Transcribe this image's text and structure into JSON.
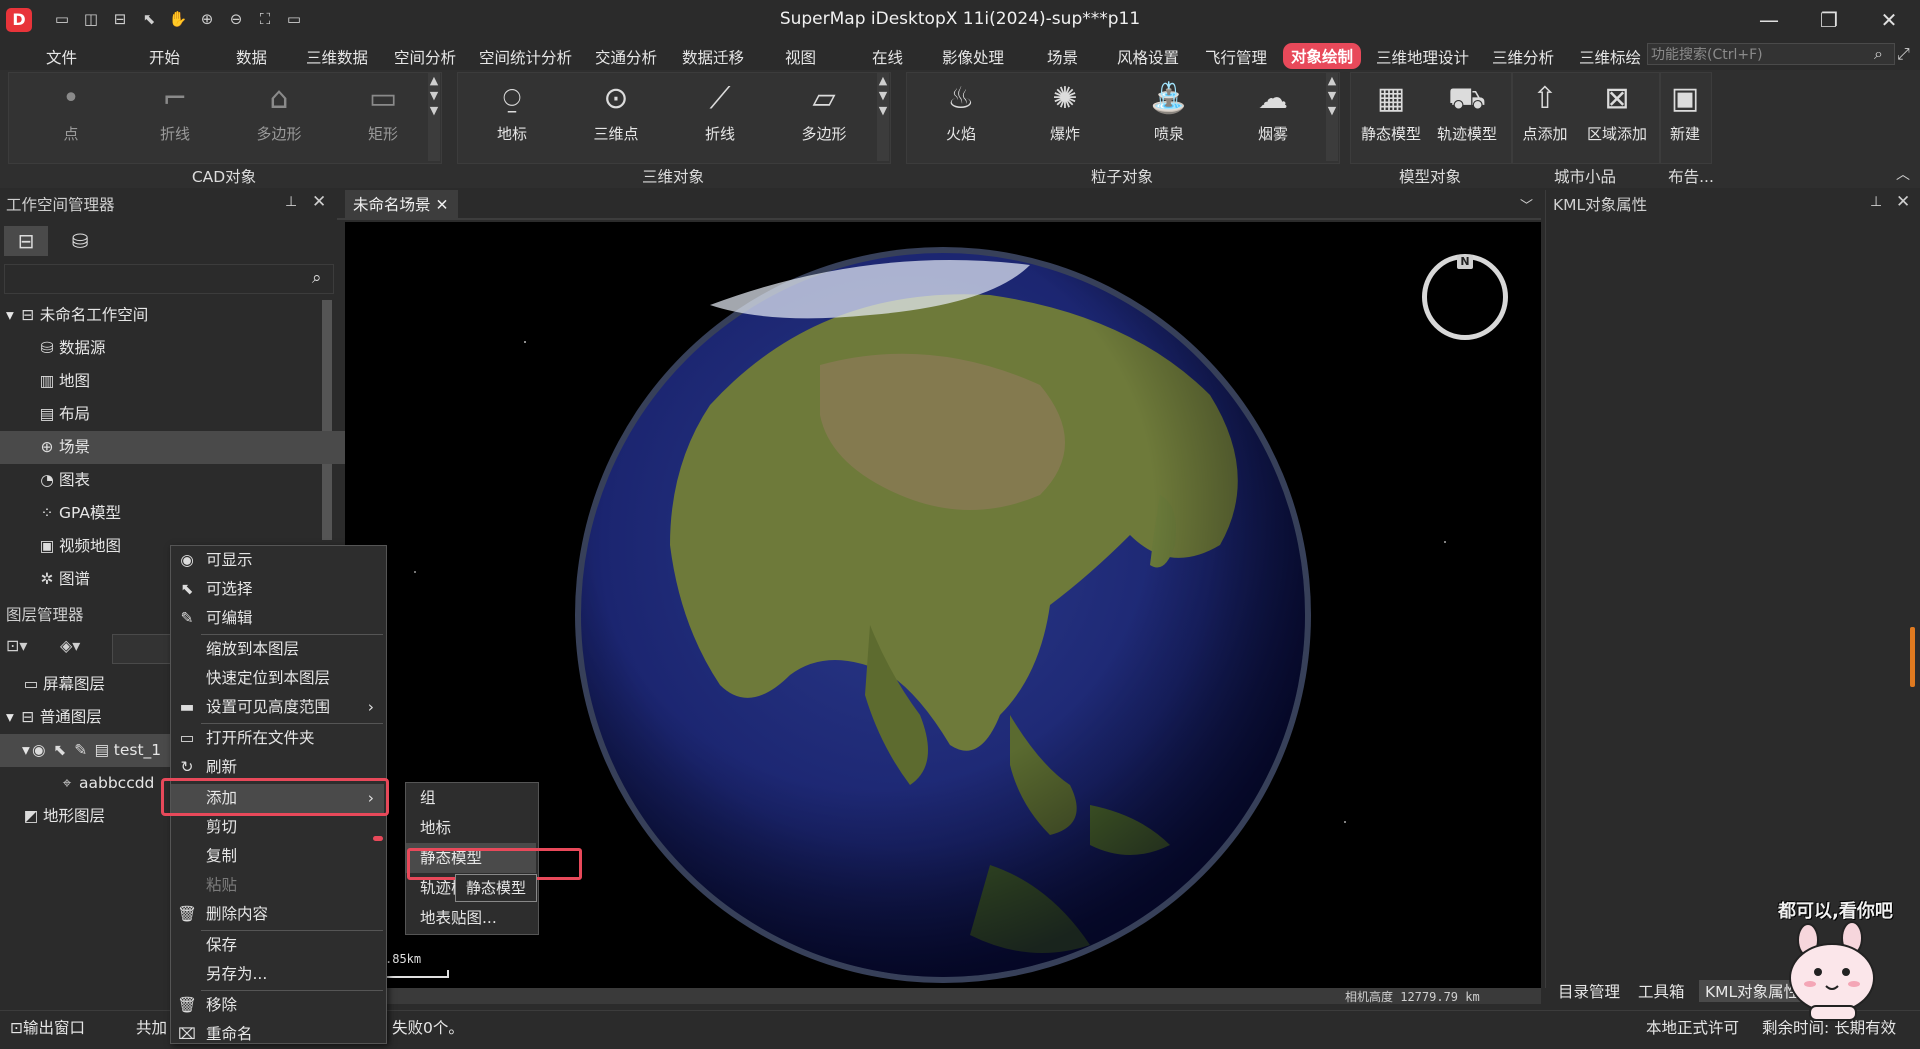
{
  "titlebar": {
    "logo": "D",
    "title": "SuperMap iDesktopX 11i(2024)-sup***p11",
    "quick_access_icons": [
      "save-icon",
      "open-workspace-icon",
      "close-workspace-icon",
      "select-icon",
      "pan-icon",
      "zoom-in-icon",
      "zoom-out-icon",
      "full-extent-icon",
      "folder-icon"
    ],
    "window_buttons": [
      "minimize-icon",
      "restore-icon",
      "close-icon"
    ]
  },
  "menu": {
    "items": [
      "文件",
      "开始",
      "数据",
      "三维数据",
      "空间分析",
      "空间统计分析",
      "交通分析",
      "数据迁移",
      "视图",
      "在线",
      "影像处理",
      "场景",
      "风格设置",
      "飞行管理",
      "对象绘制",
      "三维地理设计",
      "三维分析",
      "三维标绘"
    ],
    "active": "对象绘制",
    "search_placeholder": "功能搜索(Ctrl+F)"
  },
  "ribbon": {
    "cad": {
      "label": "CAD对象",
      "buttons": [
        {
          "label": "点",
          "icon": "point-icon"
        },
        {
          "label": "折线",
          "icon": "polyline-icon"
        },
        {
          "label": "多边形",
          "icon": "polygon-icon"
        },
        {
          "label": "矩形",
          "icon": "rectangle-icon"
        }
      ]
    },
    "three_d": {
      "label": "三维对象",
      "buttons": [
        {
          "label": "地标",
          "icon": "landmark-icon"
        },
        {
          "label": "三维点",
          "icon": "3d-point-icon"
        },
        {
          "label": "折线",
          "icon": "3d-polyline-icon"
        },
        {
          "label": "多边形",
          "icon": "3d-polygon-icon"
        }
      ]
    },
    "particle": {
      "label": "粒子对象",
      "buttons": [
        {
          "label": "火焰",
          "icon": "flame-icon"
        },
        {
          "label": "爆炸",
          "icon": "explosion-icon"
        },
        {
          "label": "喷泉",
          "icon": "fountain-icon"
        },
        {
          "label": "烟雾",
          "icon": "smoke-icon"
        }
      ]
    },
    "model": {
      "label": "模型对象",
      "buttons": [
        {
          "label": "静态模型",
          "icon": "static-model-icon"
        },
        {
          "label": "轨迹模型",
          "icon": "track-model-icon"
        }
      ]
    },
    "city": {
      "label": "城市小品",
      "buttons": [
        {
          "label": "点添加",
          "icon": "point-add-icon"
        },
        {
          "label": "区域添加",
          "icon": "region-add-icon"
        }
      ]
    },
    "board": {
      "label": "布告...",
      "buttons": [
        {
          "label": "新建",
          "icon": "new-board-icon"
        }
      ]
    }
  },
  "workspace": {
    "title": "工作空间管理器",
    "tree": [
      {
        "label": "未命名工作空间",
        "icon": "workspace-icon"
      },
      {
        "label": "数据源",
        "icon": "datasource-icon"
      },
      {
        "label": "地图",
        "icon": "map-icon"
      },
      {
        "label": "布局",
        "icon": "layout-icon"
      },
      {
        "label": "场景",
        "icon": "scene-icon"
      },
      {
        "label": "图表",
        "icon": "chart-icon"
      },
      {
        "label": "GPA模型",
        "icon": "gpa-model-icon"
      },
      {
        "label": "视频地图",
        "icon": "video-map-icon"
      },
      {
        "label": "图谱",
        "icon": "graph-icon"
      }
    ]
  },
  "layers": {
    "title": "图层管理器",
    "tree": [
      {
        "label": "屏幕图层",
        "icon": "screen-layer-icon"
      },
      {
        "label": "普通图层",
        "icon": "normal-layer-icon"
      },
      {
        "label": "test_1",
        "icon": "kml-layer-icon"
      },
      {
        "label": "aabbccdd",
        "icon": "placemark-icon"
      },
      {
        "label": "地形图层",
        "icon": "terrain-layer-icon"
      }
    ]
  },
  "scene": {
    "tab": "未命名场景",
    "scale_text": ".85km",
    "camera_height": "相机高度 12779.79 km",
    "compass_label": "N"
  },
  "kml_panel": {
    "title": "KML对象属性",
    "bottom_tabs": [
      "目录管理",
      "工具箱",
      "KML对象属性"
    ]
  },
  "context_menu": {
    "items": [
      {
        "label": "可显示",
        "icon": "eye-icon"
      },
      {
        "label": "可选择",
        "icon": "cursor-icon"
      },
      {
        "label": "可编辑",
        "icon": "pencil-icon"
      },
      {
        "label": "缩放到本图层",
        "icon": ""
      },
      {
        "label": "快速定位到本图层",
        "icon": ""
      },
      {
        "label": "设置可见高度范围",
        "icon": "height-range-icon"
      },
      {
        "label": "打开所在文件夹",
        "icon": "folder-icon"
      },
      {
        "label": "刷新",
        "icon": "refresh-icon"
      },
      {
        "label": "添加",
        "icon": ""
      },
      {
        "label": "剪切",
        "icon": ""
      },
      {
        "label": "复制",
        "icon": ""
      },
      {
        "label": "粘贴",
        "icon": ""
      },
      {
        "label": "删除内容",
        "icon": "trash-icon"
      },
      {
        "label": "保存",
        "icon": ""
      },
      {
        "label": "另存为...",
        "icon": ""
      },
      {
        "label": "移除",
        "icon": "trash-icon"
      },
      {
        "label": "重命名",
        "icon": "rename-icon"
      }
    ],
    "submenu": [
      "组",
      "地标",
      "静态模型",
      "轨迹模型",
      "地表贴图..."
    ],
    "tooltip": "静态模型"
  },
  "statusbar": {
    "output_window": "输出窗口",
    "shared": "共加",
    "message": "失败0个。",
    "license": "本地正式许可",
    "remaining": "剩余时间: 长期有效"
  },
  "sticker": {
    "text": "都可以,看你吧"
  }
}
